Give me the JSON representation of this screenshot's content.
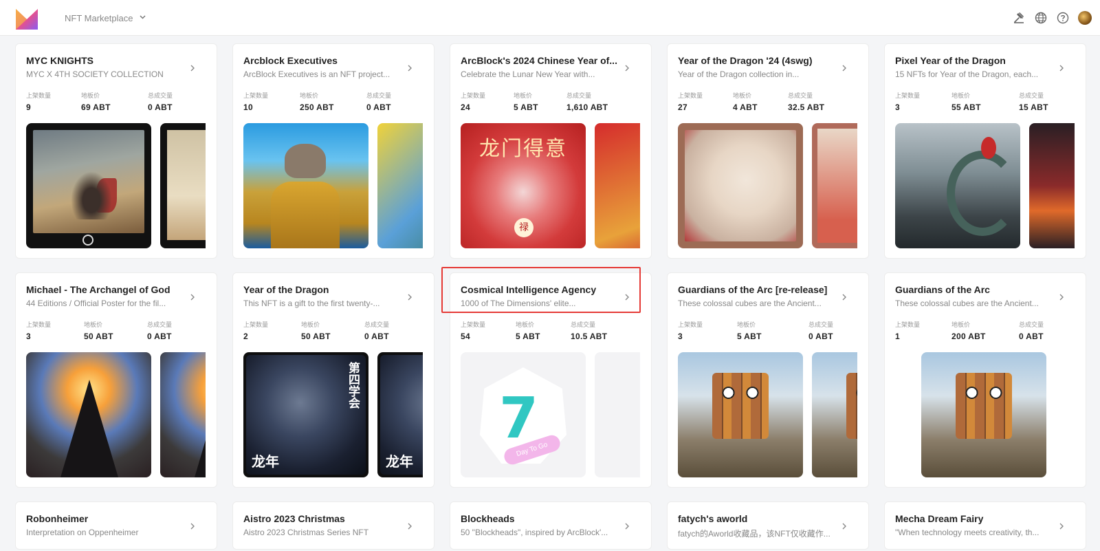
{
  "header": {
    "app_name": "NFT Marketplace",
    "brand_colors": [
      "#f5a623",
      "#e64b8f",
      "#7b5cf0"
    ]
  },
  "stat_labels": {
    "listed": "上架数量",
    "floor": "地板价",
    "volume": "总成交量"
  },
  "collections": [
    {
      "title": "MYC KNIGHTS",
      "desc": "MYC X 4TH SOCIETY COLLECTION",
      "listed": "9",
      "floor": "69 ABT",
      "volume": "0 ABT"
    },
    {
      "title": "Arcblock Executives",
      "desc": "ArcBlock Executives is an NFT project...",
      "listed": "10",
      "floor": "250 ABT",
      "volume": "0 ABT"
    },
    {
      "title": "ArcBlock's 2024 Chinese Year of...",
      "desc": "Celebrate the Lunar New Year with...",
      "listed": "24",
      "floor": "5 ABT",
      "volume": "1,610 ABT",
      "art_text": "龙门得意",
      "art_badge": "禄"
    },
    {
      "title": "Year of the Dragon '24 (4swg)",
      "desc": "Year of the Dragon collection in...",
      "listed": "27",
      "floor": "4 ABT",
      "volume": "32.5 ABT"
    },
    {
      "title": "Pixel Year of the Dragon",
      "desc": "15 NFTs for Year of the Dragon, each...",
      "listed": "3",
      "floor": "55 ABT",
      "volume": "15 ABT"
    },
    {
      "title": "Michael - The Archangel of God",
      "desc": "44 Editions / Official Poster for the fil...",
      "listed": "3",
      "floor": "50 ABT",
      "volume": "0 ABT"
    },
    {
      "title": "Year of the Dragon",
      "desc": "This NFT is a gift to the first twenty-...",
      "listed": "2",
      "floor": "50 ABT",
      "volume": "0 ABT",
      "art_text": "龙年",
      "art_vtext": "第四学会"
    },
    {
      "title": "Cosmical Intelligence Agency",
      "desc": "1000 of The Dimensions' elite...",
      "listed": "54",
      "floor": "5 ABT",
      "volume": "10.5 ABT",
      "art_ribbon": "Day To Go"
    },
    {
      "title": "Guardians of the Arc [re-release]",
      "desc": "These colossal cubes are the Ancient...",
      "listed": "3",
      "floor": "5 ABT",
      "volume": "0 ABT"
    },
    {
      "title": "Guardians of the Arc",
      "desc": "These colossal cubes are the Ancient...",
      "listed": "1",
      "floor": "200 ABT",
      "volume": "0 ABT"
    },
    {
      "title": "Robonheimer",
      "desc": "Interpretation on Oppenheimer"
    },
    {
      "title": "Aistro 2023 Christmas",
      "desc": "Aistro 2023 Christmas Series NFT"
    },
    {
      "title": "Blockheads",
      "desc": "50 \"Blockheads\", inspired by ArcBlock'..."
    },
    {
      "title": "fatych's aworld",
      "desc": "fatych的Aworld收藏品，该NFT仅收藏作..."
    },
    {
      "title": "Mecha Dream Fairy",
      "desc": "\"When technology meets creativity, th..."
    }
  ],
  "highlight_color": "#e53935"
}
